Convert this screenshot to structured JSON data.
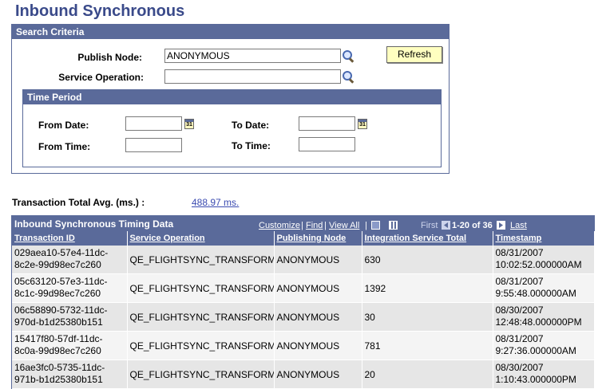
{
  "page": {
    "title": "Inbound Synchronous"
  },
  "search": {
    "header": "Search Criteria",
    "publish_node_label": "Publish Node:",
    "publish_node_value": "ANONYMOUS",
    "service_operation_label": "Service Operation:",
    "service_operation_value": "",
    "refresh_label": "Refresh",
    "time_period": {
      "header": "Time Period",
      "from_date_label": "From Date:",
      "to_date_label": "To Date:",
      "from_time_label": "From Time:",
      "to_time_label": "To Time:",
      "from_date_value": "",
      "to_date_value": "",
      "from_time_value": "",
      "to_time_value": "",
      "calendar_glyph": "31"
    }
  },
  "summary": {
    "label": "Transaction Total Avg. (ms.) :",
    "value": "488.97 ms."
  },
  "grid": {
    "title": "Inbound Synchronous Timing Data",
    "nav": {
      "customize": "Customize",
      "sep1": "|",
      "find": "Find",
      "sep2": "|",
      "view_all": "View All",
      "sep3": "|",
      "first": "First",
      "range": "1-20 of 36",
      "last": "Last"
    },
    "columns": [
      "Transaction ID",
      "Service Operation",
      "Publishing Node",
      "Integration Service Total",
      "Timestamp"
    ],
    "rows": [
      {
        "id_line1": "029aea10-57e4-11dc-",
        "id_line2": "8c2e-99d98ec7c260",
        "operation": "QE_FLIGHTSYNC_TRANSFORM",
        "node": "ANONYMOUS",
        "total": "630",
        "ts_line1": "08/31/2007",
        "ts_line2": "10:02:52.000000AM"
      },
      {
        "id_line1": "05c63120-57e3-11dc-",
        "id_line2": "8c1c-99d98ec7c260",
        "operation": "QE_FLIGHTSYNC_TRANSFORM",
        "node": "ANONYMOUS",
        "total": "1392",
        "ts_line1": "08/31/2007",
        "ts_line2": "9:55:48.000000AM"
      },
      {
        "id_line1": "06c58890-5732-11dc-",
        "id_line2": "970d-b1d25380b151",
        "operation": "QE_FLIGHTSYNC_TRANSFORM",
        "node": "ANONYMOUS",
        "total": "30",
        "ts_line1": "08/30/2007",
        "ts_line2": "12:48:48.000000PM"
      },
      {
        "id_line1": "15417f80-57df-11dc-",
        "id_line2": "8c0a-99d98ec7c260",
        "operation": "QE_FLIGHTSYNC_TRANSFORM",
        "node": "ANONYMOUS",
        "total": "781",
        "ts_line1": "08/31/2007",
        "ts_line2": "9:27:36.000000AM"
      },
      {
        "id_line1": "16ae3fc0-5735-11dc-",
        "id_line2": "971b-b1d25380b151",
        "operation": "QE_FLIGHTSYNC_TRANSFORM",
        "node": "ANONYMOUS",
        "total": "20",
        "ts_line1": "08/30/2007",
        "ts_line2": "1:10:43.000000PM"
      }
    ]
  },
  "colors": {
    "header_bg": "#5a6a9a",
    "title": "#3a4a8a",
    "link": "#3a4ab0",
    "button_bg": "#ffffc0"
  }
}
